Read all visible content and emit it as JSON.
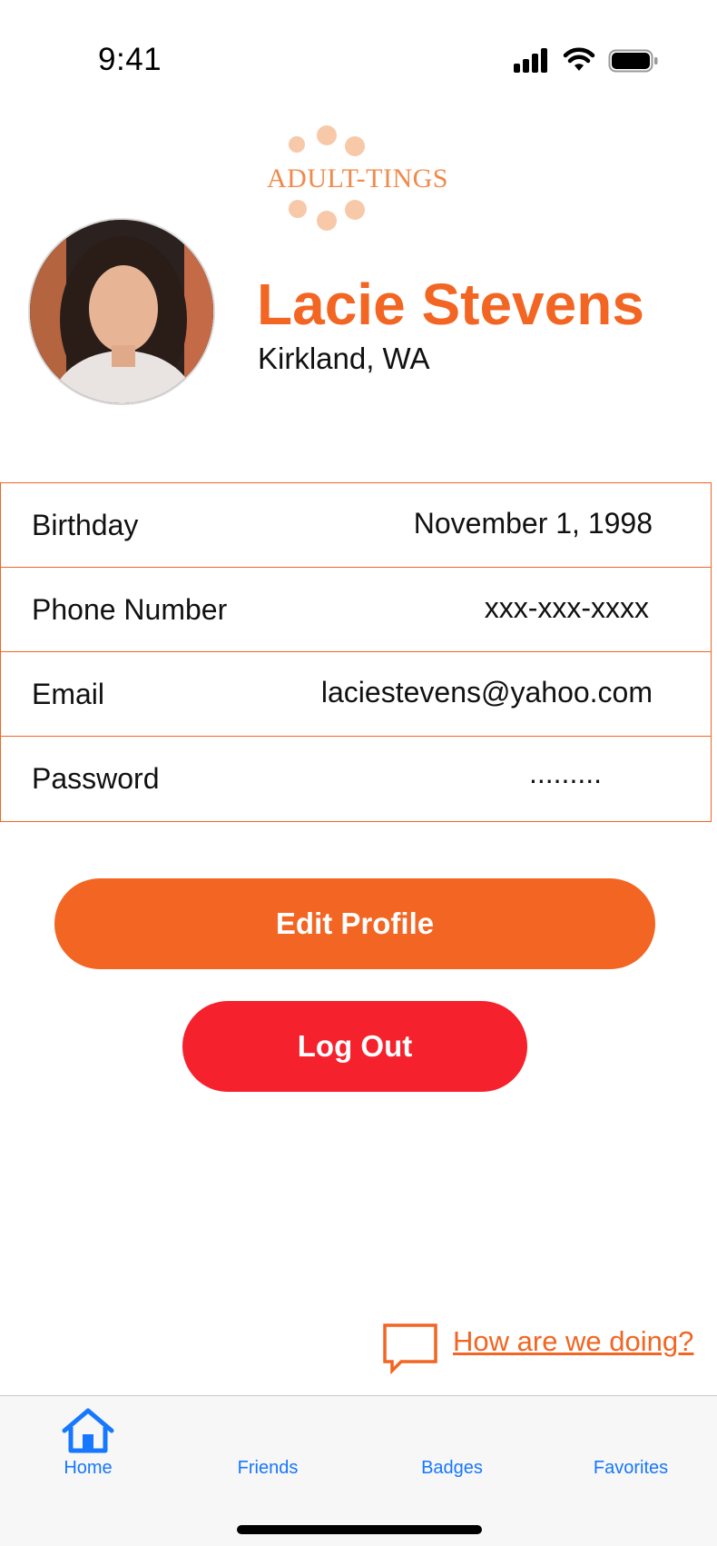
{
  "status_bar": {
    "time": "9:41"
  },
  "logo": {
    "text": "ADULT-TINGS"
  },
  "profile": {
    "name": "Lacie Stevens",
    "location": "Kirkland, WA"
  },
  "info_rows": [
    {
      "label": "Birthday",
      "value": "November 1, 1998"
    },
    {
      "label": "Phone Number",
      "value": "xxx-xxx-xxxx"
    },
    {
      "label": "Email",
      "value": "laciestevens@yahoo.com"
    },
    {
      "label": "Password",
      "value": "........."
    }
  ],
  "buttons": {
    "edit_profile": "Edit Profile",
    "log_out": "Log Out"
  },
  "feedback": {
    "link": "How are we doing?"
  },
  "tab_bar": {
    "items": [
      {
        "label": "Home",
        "icon": "home-icon"
      },
      {
        "label": "Friends"
      },
      {
        "label": "Badges"
      },
      {
        "label": "Favorites"
      }
    ]
  },
  "colors": {
    "accent": "#f26522",
    "danger": "#f5222d",
    "tab_active": "#1677ff"
  }
}
